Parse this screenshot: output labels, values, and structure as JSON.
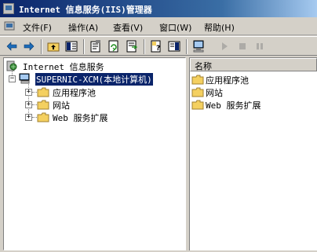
{
  "window": {
    "title": "Internet 信息服务(IIS)管理器"
  },
  "menu": {
    "items": [
      {
        "label": "文件(F)"
      },
      {
        "label": "操作(A)"
      },
      {
        "label": "查看(V)"
      },
      {
        "label": "窗口(W)"
      },
      {
        "label": "帮助(H)"
      }
    ]
  },
  "toolbar": {
    "buttons": [
      {
        "icon": "back-arrow-icon",
        "enabled": true
      },
      {
        "icon": "forward-arrow-icon",
        "enabled": true
      },
      {
        "icon": "up-folder-icon",
        "enabled": true
      },
      {
        "icon": "show-hide-tree-icon",
        "enabled": true
      },
      {
        "icon": "properties-icon",
        "enabled": true
      },
      {
        "icon": "refresh-icon",
        "enabled": true
      },
      {
        "icon": "export-list-icon",
        "enabled": true
      },
      {
        "icon": "help-icon",
        "enabled": true
      },
      {
        "icon": "console-pane-icon",
        "enabled": true
      },
      {
        "icon": "computer-icon",
        "enabled": true
      },
      {
        "icon": "play-icon",
        "enabled": false
      },
      {
        "icon": "stop-icon",
        "enabled": false
      },
      {
        "icon": "pause-icon",
        "enabled": false
      }
    ]
  },
  "tree": {
    "root": "Internet 信息服务",
    "server": "SUPERNIC-XCM(本地计算机)",
    "children": [
      {
        "label": "应用程序池"
      },
      {
        "label": "网站"
      },
      {
        "label": "Web 服务扩展"
      }
    ]
  },
  "list": {
    "column_header": "名称",
    "items": [
      {
        "label": "应用程序池"
      },
      {
        "label": "网站"
      },
      {
        "label": "Web 服务扩展"
      }
    ]
  },
  "colors": {
    "title_bar": "#0a246a",
    "selection": "#0a246a",
    "folder": "#f4d060",
    "chrome": "#d4d0c8"
  }
}
